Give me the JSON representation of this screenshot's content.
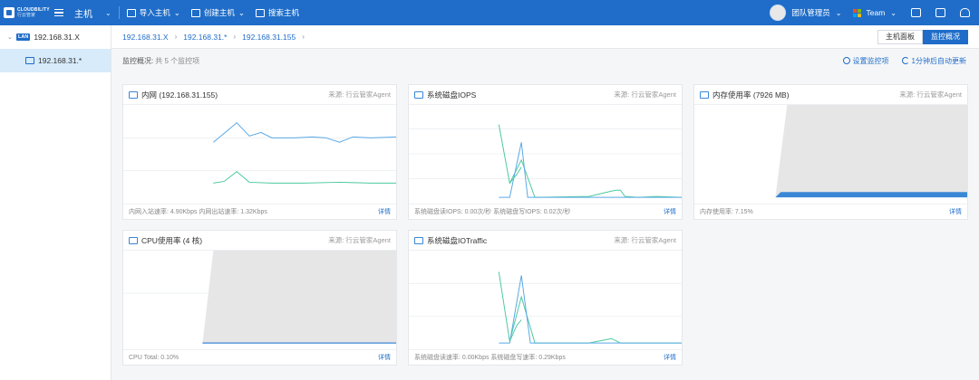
{
  "topbar": {
    "logo_text": "CLOUDBILITY",
    "logo_subtext": "行云管家",
    "section": "主机",
    "actions": [
      {
        "label": "导入主机",
        "caret": "⌄"
      },
      {
        "label": "创建主机",
        "caret": "⌄"
      },
      {
        "label": "搜索主机",
        "caret": ""
      }
    ],
    "user": "团队管理员",
    "team": "Team"
  },
  "sidebar": {
    "root": {
      "badge": "LAN",
      "label": "192.168.31.X"
    },
    "child": {
      "label": "192.168.31.*"
    }
  },
  "breadcrumb": [
    "192.168.31.X",
    "192.168.31.*",
    "192.168.31.155"
  ],
  "view_toggle": {
    "host_panel": "主机面板",
    "monitor_overview": "监控概况"
  },
  "overview": {
    "label": "监控概况:",
    "count": "共 5 个监控项",
    "set_items": "设置监控项",
    "auto_refresh": "1分钟后自动更新"
  },
  "cards": {
    "network": {
      "title": "内网 (192.168.31.155)",
      "source": "来源: 行云管家Agent",
      "footer": "内网入站速率: 4.90Kbps 内网出站速率: 1.32Kbps",
      "detail": "详情",
      "icon": "network-icon"
    },
    "disk_iops": {
      "title": "系统磁盘IOPS",
      "source": "来源: 行云管家Agent",
      "footer": "系统磁盘读IOPS: 0.00次/秒 系统磁盘写IOPS: 0.02次/秒",
      "detail": "详情",
      "icon": "disk-icon"
    },
    "memory": {
      "title": "内存使用率 (7926 MB)",
      "source": "来源: 行云管家Agent",
      "footer": "内存使用率: 7.15%",
      "detail": "详情",
      "icon": "memory-icon"
    },
    "cpu": {
      "title": "CPU使用率 (4 核)",
      "source": "来源: 行云管家Agent",
      "footer": "CPU Total: 0.10%",
      "detail": "详情",
      "icon": "cpu-icon"
    },
    "disk_traffic": {
      "title": "系统磁盘IOTraffic",
      "source": "来源: 行云管家Agent",
      "footer": "系统磁盘读速率: 0.00Kbps 系统磁盘写速率: 0.29Kbps",
      "detail": "详情",
      "icon": "disk-icon"
    }
  },
  "colors": {
    "primary": "#1f6dc9",
    "line_blue": "#5aa9e6",
    "line_green": "#4cc9a0",
    "fill_gray": "#e5e5e5",
    "fill_blue": "#3a87d6"
  }
}
